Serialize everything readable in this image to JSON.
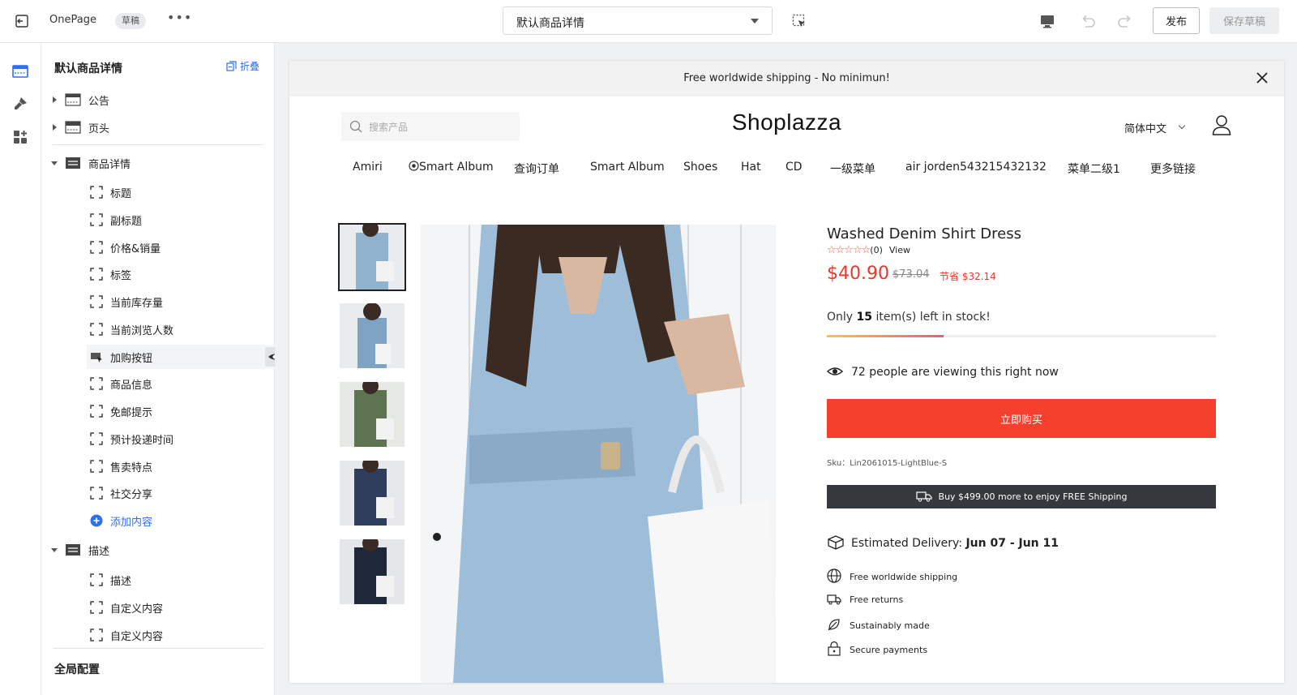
{
  "topbar": {
    "app_name": "OnePage",
    "status_badge": "草稿",
    "more": "•••",
    "template_select": "默认商品详情",
    "publish_label": "发布",
    "save_draft_label": "保存草稿"
  },
  "panel": {
    "title": "默认商品详情",
    "fold_label": "折叠",
    "sections": [
      {
        "label": "公告"
      },
      {
        "label": "页头"
      },
      {
        "label": "商品详情",
        "blocks": [
          "标题",
          "副标题",
          "价格&销量",
          "标签",
          "当前库存量",
          "当前浏览人数",
          "加购按钮",
          "商品信息",
          "免邮提示",
          "预计投递时间",
          "售卖特点",
          "社交分享"
        ],
        "add_label": "添加内容"
      },
      {
        "label": "描述",
        "blocks": [
          "描述",
          "自定义内容",
          "自定义内容"
        ]
      }
    ],
    "global_title": "全局配置"
  },
  "store": {
    "announcement": "Free worldwide shipping - No minimun!",
    "search_placeholder": "搜索产品",
    "logo": "Shoplazza",
    "language": "简体中文",
    "nav": [
      "Amiri",
      "Smart Album",
      "查询订单",
      "Smart Album",
      "Shoes",
      "Hat",
      "CD",
      "一级菜单",
      "air jorden543215432132",
      "菜单二级1",
      "更多链接"
    ]
  },
  "product": {
    "title": "Washed Denim Shirt Dress",
    "stars": "☆☆☆☆☆",
    "review_count": "(0)",
    "view_label": "View",
    "price": "$40.90",
    "compare_price": "$73.04",
    "save_text": "节省 $32.14",
    "stock_prefix": "Only ",
    "stock_count": "15",
    "stock_suffix": " item(s) left in stock!",
    "stock_progress": 0.3,
    "viewing_text": "72 people are viewing this right now",
    "buy_label": "立即购买",
    "sku": "Sku：Lin2061015-LightBlue-S",
    "shipping_bar": "Buy $499.00 more to enjoy FREE Shipping",
    "delivery_label": "Estimated Delivery:",
    "delivery_range": "Jun 07 - Jun 11",
    "features": [
      "Free worldwide shipping",
      "Free returns",
      "Sustainably made",
      "Secure payments"
    ]
  },
  "colors": {
    "accent": "#2f6fe8",
    "buy_button": "#f5402d",
    "price": "#e8392d",
    "shipping_bar": "#35383c"
  }
}
